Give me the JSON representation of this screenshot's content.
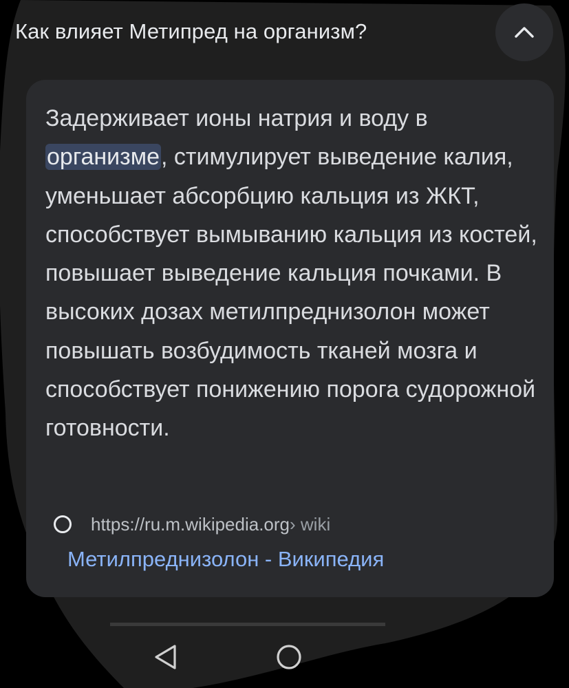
{
  "faq": {
    "question": "Как влияет Метипред на организм?",
    "expanded": true
  },
  "answer": {
    "text_before": "Задерживает ионы натрия и воду в ",
    "highlight": "организме",
    "text_after": ", стимулирует выведение калия, уменьшает абсорбцию кальция из ЖКТ, способствует вымыванию кальция из костей, повышает выведение кальция почками. В высоких дозах метилпреднизолон может повышать возбудимость тканей мозга и способствует понижению порога судорожной готовности."
  },
  "source": {
    "url": "https://ru.m.wikipedia.org",
    "path": " › wiki",
    "title": "Метилпреднизолон - Википедия",
    "favicon": "wikipedia-globe-icon"
  },
  "nav": {
    "back": "back-triangle-icon",
    "home": "home-circle-icon"
  },
  "colors": {
    "background": "#000000",
    "surface": "#2a2b2e",
    "text": "#dadce0",
    "link": "#8ab4f8",
    "highlight": "#3a4660"
  }
}
